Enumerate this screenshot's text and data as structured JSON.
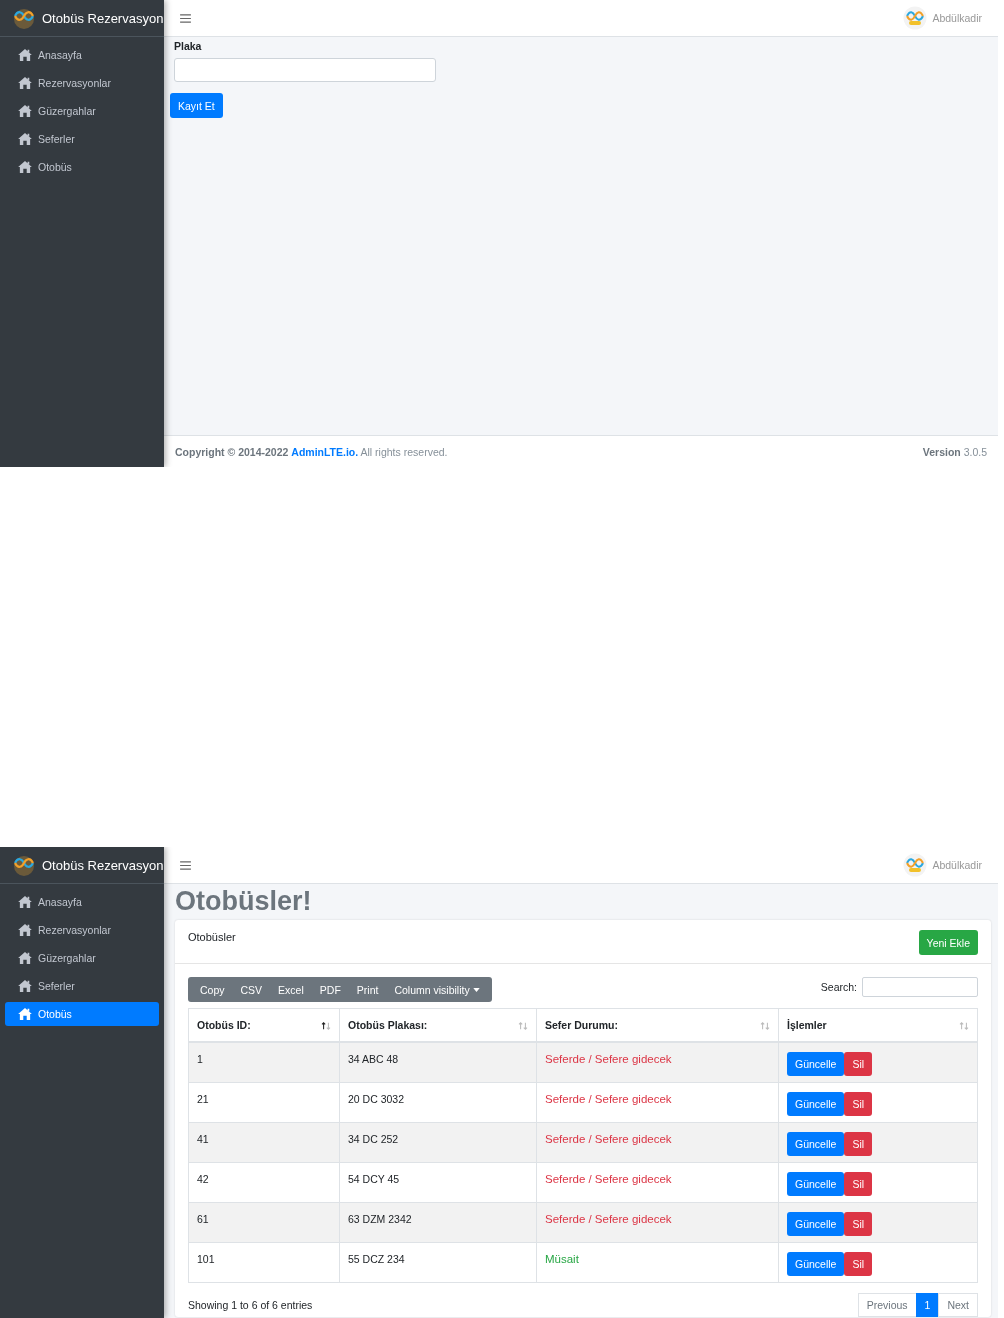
{
  "screens": [
    {
      "kind": "form",
      "brand": "Otobüs Rezervasyon",
      "user": "Abdülkadir",
      "sidebar": {
        "items": [
          {
            "label": "Anasayfa",
            "selected": false
          },
          {
            "label": "Rezervasyonlar",
            "selected": false
          },
          {
            "label": "Güzergahlar",
            "selected": false
          },
          {
            "label": "Seferler",
            "selected": false
          },
          {
            "label": "Otobüs",
            "selected": false
          }
        ]
      },
      "form": {
        "label": "Plaka",
        "submit": "Kayıt Et"
      },
      "footer": {
        "copyright": "Copyright © 2014-2022",
        "link": "AdminLTE.io.",
        "rights": "All rights reserved.",
        "version_label": "Version",
        "version": "3.0.5"
      }
    },
    {
      "kind": "list",
      "brand": "Otobüs Rezervasyon",
      "user": "Abdülkadir",
      "sidebar": {
        "items": [
          {
            "label": "Anasayfa",
            "selected": false
          },
          {
            "label": "Rezervasyonlar",
            "selected": false
          },
          {
            "label": "Güzergahlar",
            "selected": false
          },
          {
            "label": "Seferler",
            "selected": false
          },
          {
            "label": "Otobüs",
            "selected": true
          }
        ]
      },
      "title": "Otobüsler!",
      "card_title": "Otobüsler",
      "add_button": "Yeni Ekle",
      "export_buttons": [
        "Copy",
        "CSV",
        "Excel",
        "PDF",
        "Print"
      ],
      "column_visibility": "Column visibility",
      "search_label": "Search:",
      "table": {
        "columns": [
          {
            "label": "Otobüs ID:",
            "sorted": true
          },
          {
            "label": "Otobüs Plakası:",
            "sorted": false
          },
          {
            "label": "Sefer Durumu:",
            "sorted": false
          },
          {
            "label": "İşlemler",
            "sorted": false
          }
        ],
        "rows": [
          {
            "id": "1",
            "plate": "34 ABC 48",
            "status": "Seferde / Sefere gidecek",
            "color": "#dc3545",
            "update": "Güncelle",
            "delete": "Sil"
          },
          {
            "id": "21",
            "plate": "20 DC 3032",
            "status": "Seferde / Sefere gidecek",
            "color": "#dc3545",
            "update": "Güncelle",
            "delete": "Sil"
          },
          {
            "id": "41",
            "plate": "34 DC 252",
            "status": "Seferde / Sefere gidecek",
            "color": "#dc3545",
            "update": "Güncelle",
            "delete": "Sil"
          },
          {
            "id": "42",
            "plate": "54 DCY 45",
            "status": "Seferde / Sefere gidecek",
            "color": "#dc3545",
            "update": "Güncelle",
            "delete": "Sil"
          },
          {
            "id": "61",
            "plate": "63 DZM 2342",
            "status": "Seferde / Sefere gidecek",
            "color": "#dc3545",
            "update": "Güncelle",
            "delete": "Sil"
          },
          {
            "id": "101",
            "plate": "55 DCZ 234",
            "status": "Müsait",
            "color": "#28a745",
            "update": "Güncelle",
            "delete": "Sil"
          }
        ]
      },
      "info": "Showing 1 to 6 of 6 entries",
      "pagination": {
        "previous": "Previous",
        "pages": [
          {
            "label": "1",
            "selected": true
          }
        ],
        "next": "Next"
      }
    }
  ]
}
